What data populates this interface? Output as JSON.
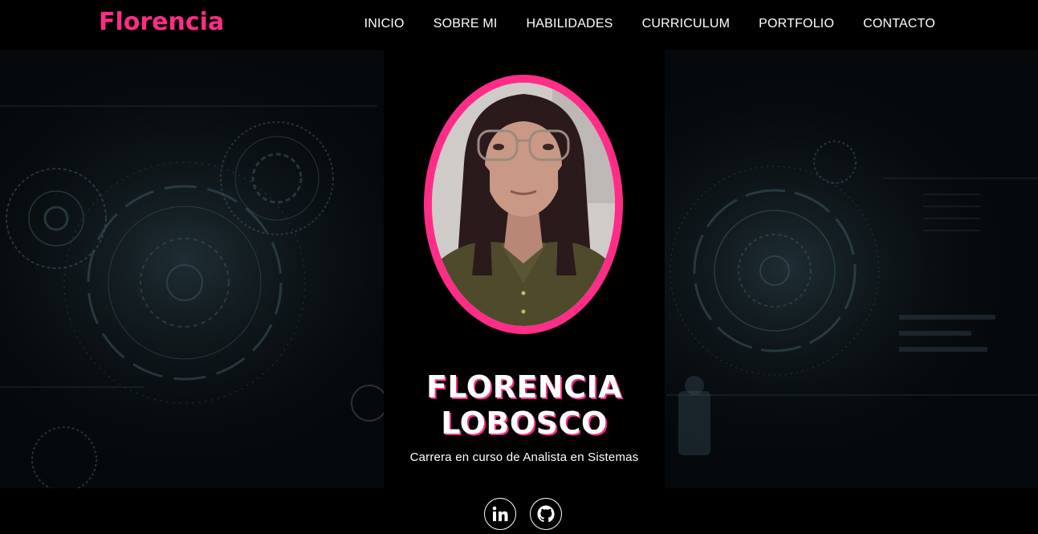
{
  "brand": {
    "name": "Florencia",
    "color": "#ff2d87"
  },
  "nav": {
    "items": [
      {
        "label": "INICIO"
      },
      {
        "label": "SOBRE MI"
      },
      {
        "label": "HABILIDADES"
      },
      {
        "label": "CURRICULUM"
      },
      {
        "label": "PORTFOLIO"
      },
      {
        "label": "CONTACTO"
      }
    ]
  },
  "profile": {
    "name_line1": "FLORENCIA",
    "name_line2": "LOBOSCO",
    "subtitle": "Carrera en curso de Analista en Sistemas",
    "photo_icon": "profile-photo"
  },
  "social": {
    "items": [
      {
        "icon": "linkedin-icon"
      },
      {
        "icon": "github-icon"
      }
    ]
  },
  "colors": {
    "accent": "#ff2d87",
    "background": "#000000",
    "text": "#ffffff"
  }
}
